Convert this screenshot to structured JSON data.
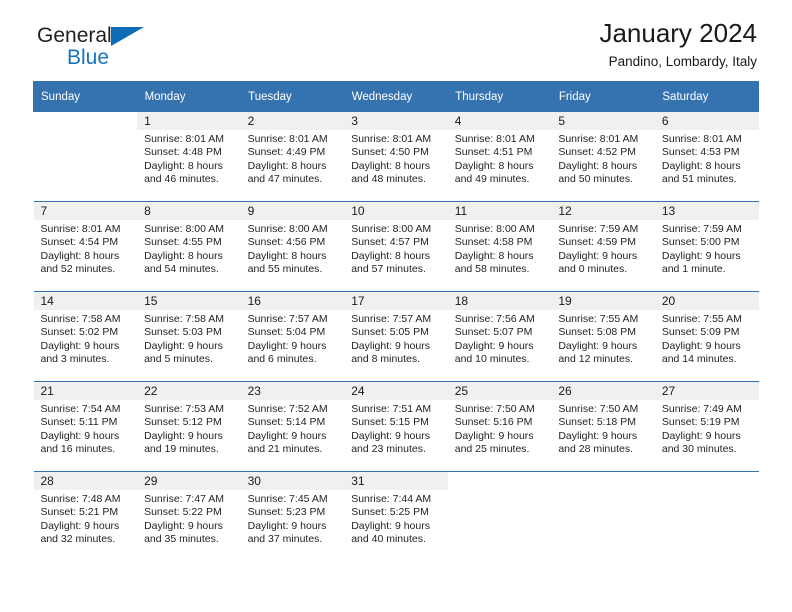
{
  "brand": {
    "line1": "General",
    "line2": "Blue",
    "triangle_color": "#0d6cb5",
    "text_color": "#231f20",
    "blue_text_color": "#1574bf"
  },
  "header": {
    "title": "January 2024",
    "subtitle": "Pandino, Lombardy, Italy"
  },
  "theme": {
    "header_bg": "#3572b0",
    "daynum_bg": "#f0f0f0",
    "text": "#231f20"
  },
  "weekdays": [
    "Sunday",
    "Monday",
    "Tuesday",
    "Wednesday",
    "Thursday",
    "Friday",
    "Saturday"
  ],
  "weeks": [
    [
      {
        "day": "",
        "sunrise": "",
        "sunset": "",
        "daylight": ""
      },
      {
        "day": "1",
        "sunrise": "Sunrise: 8:01 AM",
        "sunset": "Sunset: 4:48 PM",
        "daylight": "Daylight: 8 hours and 46 minutes."
      },
      {
        "day": "2",
        "sunrise": "Sunrise: 8:01 AM",
        "sunset": "Sunset: 4:49 PM",
        "daylight": "Daylight: 8 hours and 47 minutes."
      },
      {
        "day": "3",
        "sunrise": "Sunrise: 8:01 AM",
        "sunset": "Sunset: 4:50 PM",
        "daylight": "Daylight: 8 hours and 48 minutes."
      },
      {
        "day": "4",
        "sunrise": "Sunrise: 8:01 AM",
        "sunset": "Sunset: 4:51 PM",
        "daylight": "Daylight: 8 hours and 49 minutes."
      },
      {
        "day": "5",
        "sunrise": "Sunrise: 8:01 AM",
        "sunset": "Sunset: 4:52 PM",
        "daylight": "Daylight: 8 hours and 50 minutes."
      },
      {
        "day": "6",
        "sunrise": "Sunrise: 8:01 AM",
        "sunset": "Sunset: 4:53 PM",
        "daylight": "Daylight: 8 hours and 51 minutes."
      }
    ],
    [
      {
        "day": "7",
        "sunrise": "Sunrise: 8:01 AM",
        "sunset": "Sunset: 4:54 PM",
        "daylight": "Daylight: 8 hours and 52 minutes."
      },
      {
        "day": "8",
        "sunrise": "Sunrise: 8:00 AM",
        "sunset": "Sunset: 4:55 PM",
        "daylight": "Daylight: 8 hours and 54 minutes."
      },
      {
        "day": "9",
        "sunrise": "Sunrise: 8:00 AM",
        "sunset": "Sunset: 4:56 PM",
        "daylight": "Daylight: 8 hours and 55 minutes."
      },
      {
        "day": "10",
        "sunrise": "Sunrise: 8:00 AM",
        "sunset": "Sunset: 4:57 PM",
        "daylight": "Daylight: 8 hours and 57 minutes."
      },
      {
        "day": "11",
        "sunrise": "Sunrise: 8:00 AM",
        "sunset": "Sunset: 4:58 PM",
        "daylight": "Daylight: 8 hours and 58 minutes."
      },
      {
        "day": "12",
        "sunrise": "Sunrise: 7:59 AM",
        "sunset": "Sunset: 4:59 PM",
        "daylight": "Daylight: 9 hours and 0 minutes."
      },
      {
        "day": "13",
        "sunrise": "Sunrise: 7:59 AM",
        "sunset": "Sunset: 5:00 PM",
        "daylight": "Daylight: 9 hours and 1 minute."
      }
    ],
    [
      {
        "day": "14",
        "sunrise": "Sunrise: 7:58 AM",
        "sunset": "Sunset: 5:02 PM",
        "daylight": "Daylight: 9 hours and 3 minutes."
      },
      {
        "day": "15",
        "sunrise": "Sunrise: 7:58 AM",
        "sunset": "Sunset: 5:03 PM",
        "daylight": "Daylight: 9 hours and 5 minutes."
      },
      {
        "day": "16",
        "sunrise": "Sunrise: 7:57 AM",
        "sunset": "Sunset: 5:04 PM",
        "daylight": "Daylight: 9 hours and 6 minutes."
      },
      {
        "day": "17",
        "sunrise": "Sunrise: 7:57 AM",
        "sunset": "Sunset: 5:05 PM",
        "daylight": "Daylight: 9 hours and 8 minutes."
      },
      {
        "day": "18",
        "sunrise": "Sunrise: 7:56 AM",
        "sunset": "Sunset: 5:07 PM",
        "daylight": "Daylight: 9 hours and 10 minutes."
      },
      {
        "day": "19",
        "sunrise": "Sunrise: 7:55 AM",
        "sunset": "Sunset: 5:08 PM",
        "daylight": "Daylight: 9 hours and 12 minutes."
      },
      {
        "day": "20",
        "sunrise": "Sunrise: 7:55 AM",
        "sunset": "Sunset: 5:09 PM",
        "daylight": "Daylight: 9 hours and 14 minutes."
      }
    ],
    [
      {
        "day": "21",
        "sunrise": "Sunrise: 7:54 AM",
        "sunset": "Sunset: 5:11 PM",
        "daylight": "Daylight: 9 hours and 16 minutes."
      },
      {
        "day": "22",
        "sunrise": "Sunrise: 7:53 AM",
        "sunset": "Sunset: 5:12 PM",
        "daylight": "Daylight: 9 hours and 19 minutes."
      },
      {
        "day": "23",
        "sunrise": "Sunrise: 7:52 AM",
        "sunset": "Sunset: 5:14 PM",
        "daylight": "Daylight: 9 hours and 21 minutes."
      },
      {
        "day": "24",
        "sunrise": "Sunrise: 7:51 AM",
        "sunset": "Sunset: 5:15 PM",
        "daylight": "Daylight: 9 hours and 23 minutes."
      },
      {
        "day": "25",
        "sunrise": "Sunrise: 7:50 AM",
        "sunset": "Sunset: 5:16 PM",
        "daylight": "Daylight: 9 hours and 25 minutes."
      },
      {
        "day": "26",
        "sunrise": "Sunrise: 7:50 AM",
        "sunset": "Sunset: 5:18 PM",
        "daylight": "Daylight: 9 hours and 28 minutes."
      },
      {
        "day": "27",
        "sunrise": "Sunrise: 7:49 AM",
        "sunset": "Sunset: 5:19 PM",
        "daylight": "Daylight: 9 hours and 30 minutes."
      }
    ],
    [
      {
        "day": "28",
        "sunrise": "Sunrise: 7:48 AM",
        "sunset": "Sunset: 5:21 PM",
        "daylight": "Daylight: 9 hours and 32 minutes."
      },
      {
        "day": "29",
        "sunrise": "Sunrise: 7:47 AM",
        "sunset": "Sunset: 5:22 PM",
        "daylight": "Daylight: 9 hours and 35 minutes."
      },
      {
        "day": "30",
        "sunrise": "Sunrise: 7:45 AM",
        "sunset": "Sunset: 5:23 PM",
        "daylight": "Daylight: 9 hours and 37 minutes."
      },
      {
        "day": "31",
        "sunrise": "Sunrise: 7:44 AM",
        "sunset": "Sunset: 5:25 PM",
        "daylight": "Daylight: 9 hours and 40 minutes."
      },
      {
        "day": "",
        "sunrise": "",
        "sunset": "",
        "daylight": ""
      },
      {
        "day": "",
        "sunrise": "",
        "sunset": "",
        "daylight": ""
      },
      {
        "day": "",
        "sunrise": "",
        "sunset": "",
        "daylight": ""
      }
    ]
  ]
}
